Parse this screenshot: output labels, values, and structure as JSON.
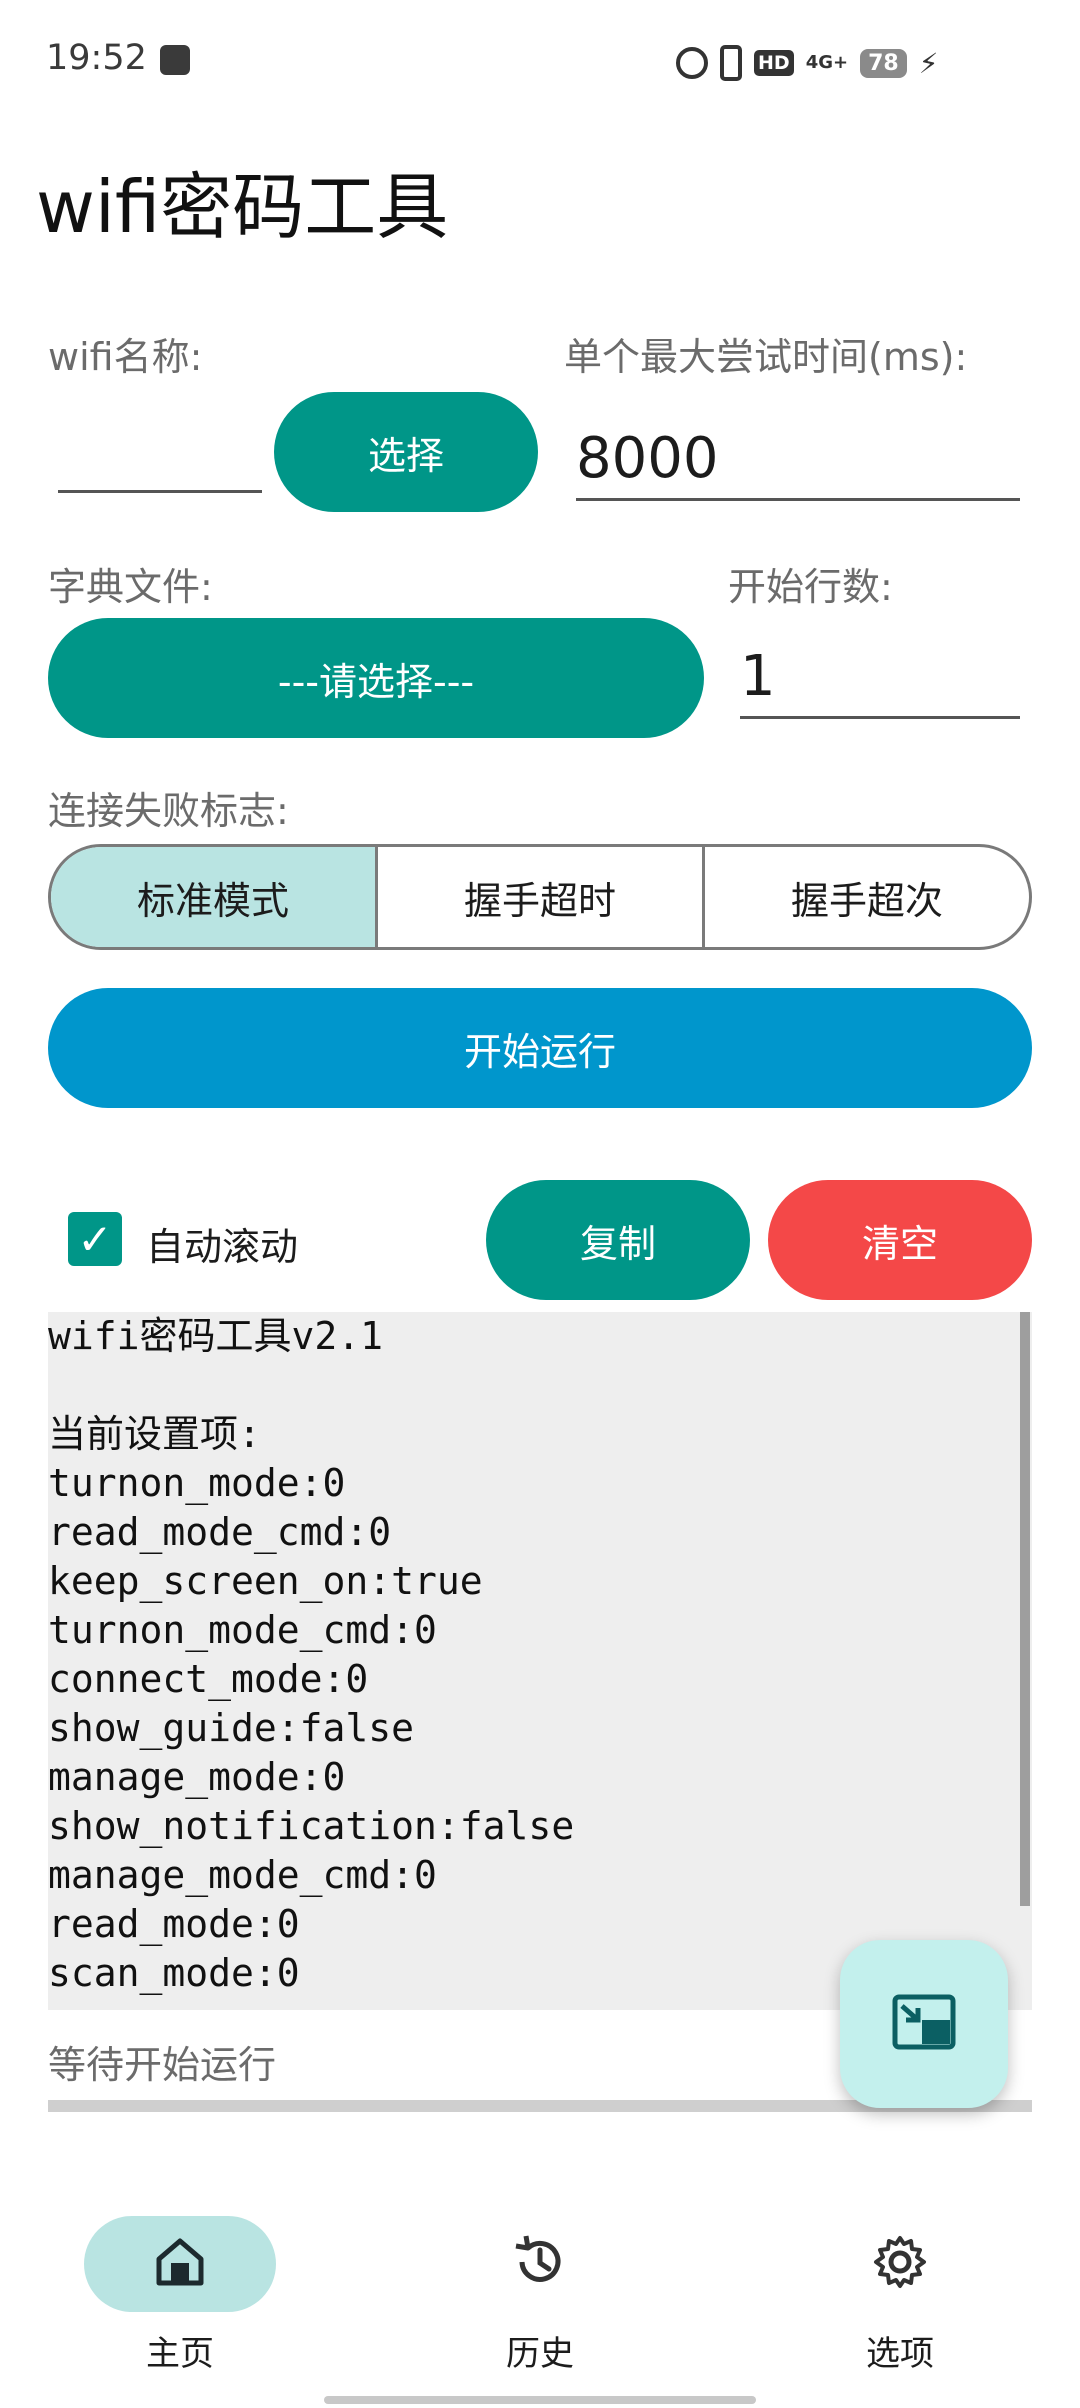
{
  "status_bar": {
    "time": "19:52",
    "hd": "HD",
    "network": "4G+",
    "battery": "78",
    "icons": [
      "gallery-icon",
      "alarm-icon",
      "vibrate-icon",
      "hd-icon",
      "signal-icon",
      "battery-icon",
      "charging-icon"
    ]
  },
  "app": {
    "title": "wifi密码工具"
  },
  "form": {
    "wifi_name_label": "wifi名称:",
    "wifi_name_value": "",
    "select_button": "选择",
    "max_time_label": "单个最大尝试时间(ms):",
    "max_time_value": "8000",
    "dict_label": "字典文件:",
    "dict_button": "---请选择---",
    "start_line_label": "开始行数:",
    "start_line_value": "1",
    "fail_flag_label": "连接失败标志:",
    "modes": [
      "标准模式",
      "握手超时",
      "握手超次"
    ],
    "selected_mode": "标准模式"
  },
  "actions": {
    "start_button": "开始运行",
    "auto_scroll_label": "自动滚动",
    "auto_scroll_checked": true,
    "copy_button": "复制",
    "clear_button": "清空"
  },
  "log": {
    "lines": [
      "wifi密码工具v2.1",
      "",
      "当前设置项:",
      "turnon_mode:0",
      "read_mode_cmd:0",
      "keep_screen_on:true",
      "turnon_mode_cmd:0",
      "connect_mode:0",
      "show_guide:false",
      "manage_mode:0",
      "show_notification:false",
      "manage_mode_cmd:0",
      "read_mode:0",
      "scan_mode:0"
    ],
    "status": "等待开始运行"
  },
  "nav": {
    "items": [
      {
        "label": "主页",
        "icon": "home-icon",
        "active": true
      },
      {
        "label": "历史",
        "icon": "history-icon",
        "active": false
      },
      {
        "label": "选项",
        "icon": "settings-icon",
        "active": false
      }
    ]
  },
  "colors": {
    "teal": "#009688",
    "blue": "#0096cc",
    "red": "#f44848",
    "selected_segment": "#b9e4e2",
    "log_bg": "#eeeeee"
  }
}
